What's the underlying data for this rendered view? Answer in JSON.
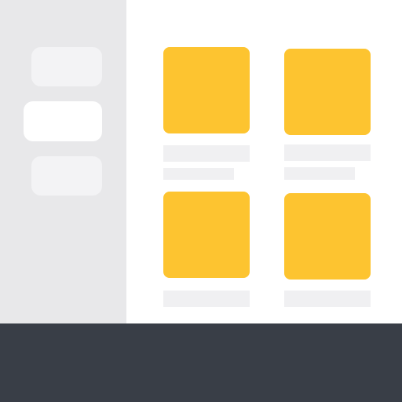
{
  "theme": {
    "sidebar_bg": "#e8e8ea",
    "side_item": "#f3f3f5",
    "side_item_selected": "#ffffff",
    "main_bg": "#ffffff",
    "accent": "#fdc430",
    "placeholder": "#f0f0f2",
    "footer_bg": "#393e47"
  },
  "sidebar": {
    "items": [
      {
        "label": "",
        "selected": false
      },
      {
        "label": "",
        "selected": true
      },
      {
        "label": "",
        "selected": false
      }
    ]
  },
  "grid": {
    "cards": [
      {
        "title": "",
        "subtitle": ""
      },
      {
        "title": "",
        "subtitle": ""
      },
      {
        "title": "",
        "subtitle": ""
      },
      {
        "title": "",
        "subtitle": ""
      }
    ]
  }
}
